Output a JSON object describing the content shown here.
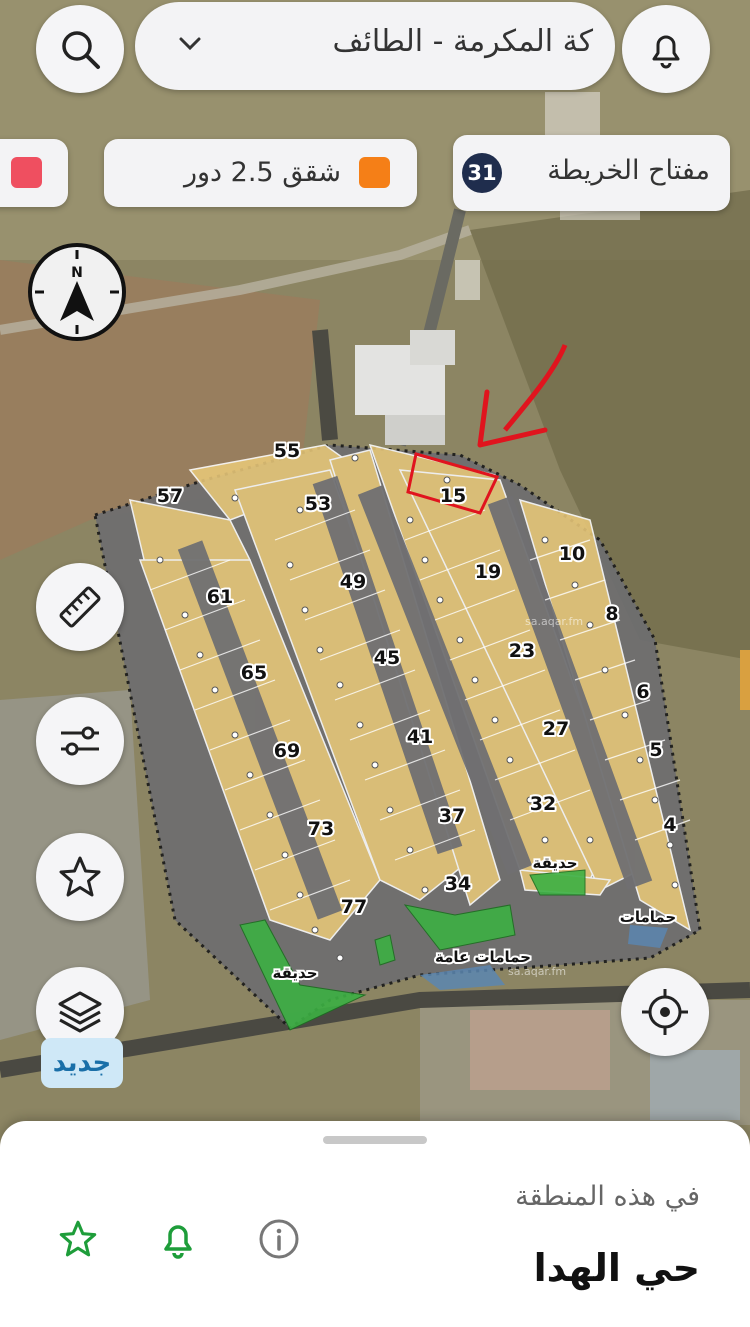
{
  "search": {
    "location_text": "كة المكرمة  -  الطائف"
  },
  "legend": {
    "map_key_label": "مفتاح الخريطة",
    "map_key_count": "31",
    "apartments_label": "شقق 2.5 دور",
    "apartments_color": "#f57f17",
    "other_color": "#ef4f60"
  },
  "compass_letter": "N",
  "badge_new": "جديد",
  "map": {
    "plot_numbers": [
      "55",
      "57",
      "53",
      "15",
      "10",
      "19",
      "49",
      "61",
      "8",
      "23",
      "45",
      "65",
      "6",
      "27",
      "41",
      "69",
      "5",
      "32",
      "37",
      "73",
      "4",
      "34",
      "77"
    ],
    "area_labels": {
      "garden_right": "حديقة",
      "garden_left": "حديقة",
      "toilets": "حمامات",
      "public_toilets": "حمامات عامة"
    },
    "watermark": "sa.aqar.fm",
    "parcel_color": "#e8c879",
    "garden_color": "#3cb043",
    "annotation_color": "#e0141e"
  },
  "sheet": {
    "subtitle": "في هذه المنطقة",
    "title": "حي الهدا"
  },
  "icons": [
    "search-icon",
    "chevron-down-icon",
    "bell-icon",
    "ruler-icon",
    "sliders-icon",
    "star-icon",
    "layers-icon",
    "crosshair-icon",
    "info-icon"
  ]
}
